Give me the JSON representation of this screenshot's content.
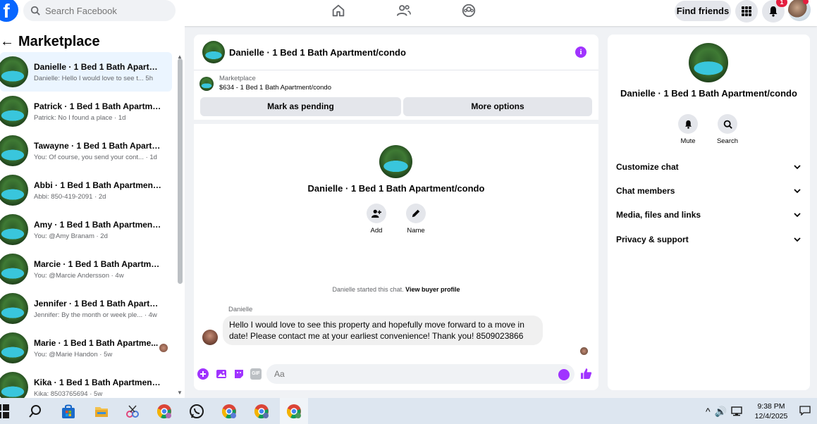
{
  "topbar": {
    "logo_letter": "f",
    "search_placeholder": "Search Facebook",
    "find_friends_label": "Find friends",
    "notification_count": "1",
    "icons": [
      "facebook-logo",
      "search-icon",
      "home-icon",
      "friends-icon",
      "groups-icon",
      "menu-grid-icon",
      "bell-icon",
      "profile-avatar"
    ]
  },
  "sidebar": {
    "back_arrow": "←",
    "title": "Marketplace",
    "conversations": [
      {
        "title": "Danielle · 1 Bed 1 Bath Apartme...",
        "snippet": "Danielle: Hello I would love to see t... 5h",
        "active": true
      },
      {
        "title": "Patrick · 1 Bed 1 Bath Apartment...",
        "snippet": "Patrick: No I found a place · 1d"
      },
      {
        "title": "Tawayne · 1 Bed 1 Bath Apartme...",
        "snippet": "You: Of course, you send your cont... · 1d"
      },
      {
        "title": "Abbi · 1 Bed 1 Bath Apartment/c...",
        "snippet": "Abbi: 850-419-2091 · 2d"
      },
      {
        "title": "Amy · 1 Bed 1 Bath Apartment/c...",
        "snippet": "You: @Amy Branam · 2d"
      },
      {
        "title": "Marcie · 1 Bed 1 Bath Apartment...",
        "snippet": "You: @Marcie Andersson · 4w"
      },
      {
        "title": "Jennifer · 1 Bed 1 Bath Apartmen...",
        "snippet": "Jennifer: By the month or week ple... · 4w"
      },
      {
        "title": "Marie · 1 Bed 1 Bath Apartme...",
        "snippet": "You: @Marie Handon · 5w"
      },
      {
        "title": "Kika · 1 Bed 1 Bath Apartment/c...",
        "snippet": "Kika: 8503765694 · 5w"
      }
    ]
  },
  "chat": {
    "title": "Danielle · 1 Bed 1 Bath Apartment/condo",
    "info_glyph": "i",
    "listing_source": "Marketplace",
    "listing_price_title": "$634 - 1 Bed 1 Bath Apartment/condo",
    "mark_pending_label": "Mark as pending",
    "more_options_label": "More options",
    "profile_name": "Danielle · 1 Bed 1 Bath Apartment/condo",
    "add_label": "Add",
    "name_label": "Name",
    "started_text": "Danielle started this chat.",
    "view_buyer_profile": "View buyer profile",
    "message_sender": "Danielle",
    "message_text": "Hello I would love to see this property and hopefully move forward to a move in date! Please contact me at your earliest convenience! Thank you! 8509023866",
    "composer_placeholder": "Aa",
    "composer_gif": "GIF"
  },
  "details": {
    "name": "Danielle · 1 Bed 1 Bath Apartment/condo",
    "mute_label": "Mute",
    "search_label": "Search",
    "sections": [
      "Customize chat",
      "Chat members",
      "Media, files and links",
      "Privacy & support"
    ]
  },
  "taskbar": {
    "time": "9:38 PM",
    "date": "12/4/2025",
    "tray_caret": "^",
    "tray_volume": "🔊"
  },
  "colors": {
    "facebook_blue": "#0866ff",
    "messenger_purple": "#a033ff",
    "notification_red": "#e41e3f"
  }
}
